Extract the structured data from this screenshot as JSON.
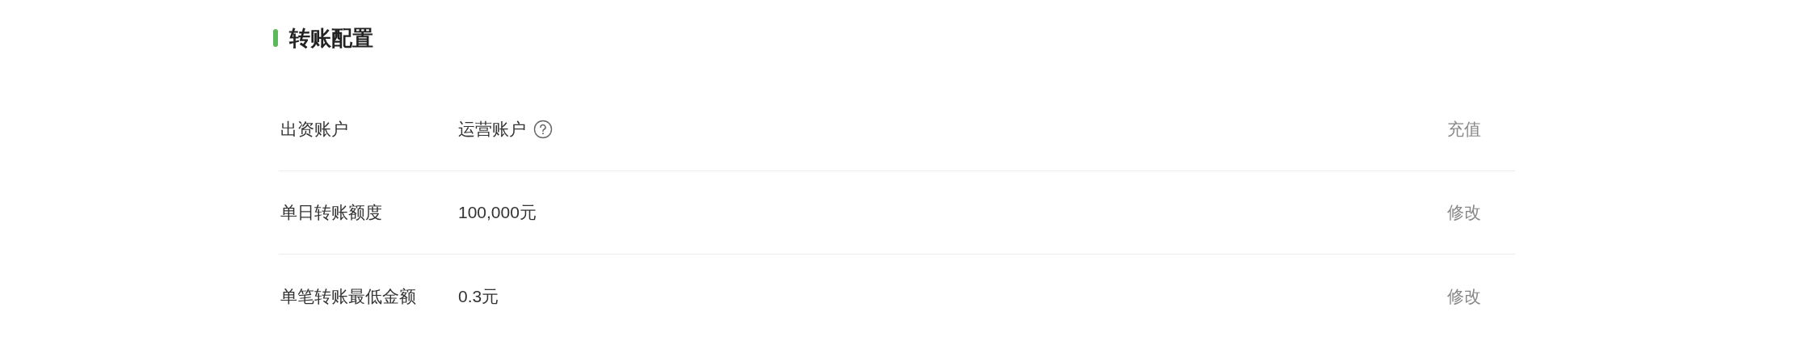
{
  "section": {
    "title": "转账配置"
  },
  "rows": [
    {
      "label": "出资账户",
      "value": "运营账户",
      "help": true,
      "action": "充值"
    },
    {
      "label": "单日转账额度",
      "value": "100,000元",
      "help": false,
      "action": "修改"
    },
    {
      "label": "单笔转账最低金额",
      "value": "0.3元",
      "help": false,
      "action": "修改"
    }
  ]
}
